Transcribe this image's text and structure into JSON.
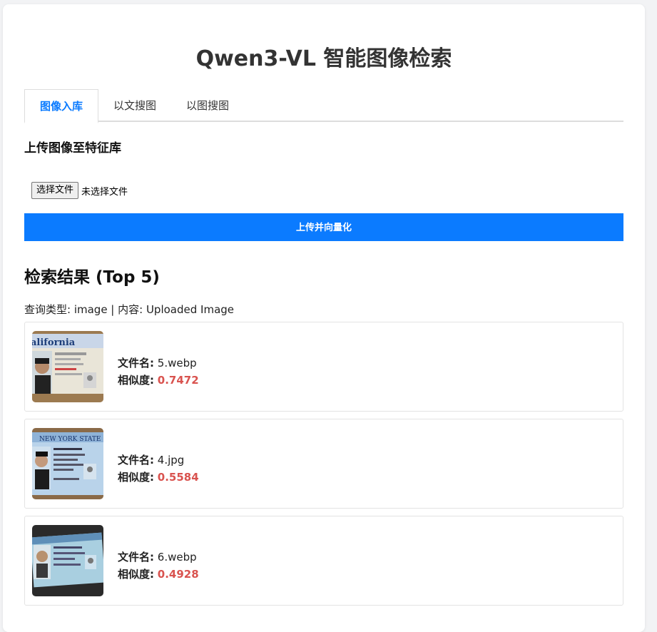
{
  "app": {
    "title": "Qwen3-VL 智能图像检索"
  },
  "tabs": [
    {
      "label": "图像入库",
      "active": true
    },
    {
      "label": "以文搜图",
      "active": false
    },
    {
      "label": "以图搜图",
      "active": false
    }
  ],
  "upload": {
    "section_title": "上传图像至特征库",
    "choose_file_label": "选择文件",
    "file_status": "未选择文件",
    "submit_label": "上传并向量化"
  },
  "results": {
    "title": "检索结果 (Top 5)",
    "query_info": "查询类型: image | 内容: Uploaded Image",
    "filename_label": "文件名:",
    "similarity_label": "相似度:",
    "items": [
      {
        "filename": "5.webp",
        "similarity": "0.7472",
        "thumb_text": "alifornia"
      },
      {
        "filename": "4.jpg",
        "similarity": "0.5584",
        "thumb_text": "NEW YORK STATE"
      },
      {
        "filename": "6.webp",
        "similarity": "0.4928",
        "thumb_text": ""
      }
    ]
  },
  "colors": {
    "accent": "#0b7bff",
    "score": "#d9534f"
  }
}
